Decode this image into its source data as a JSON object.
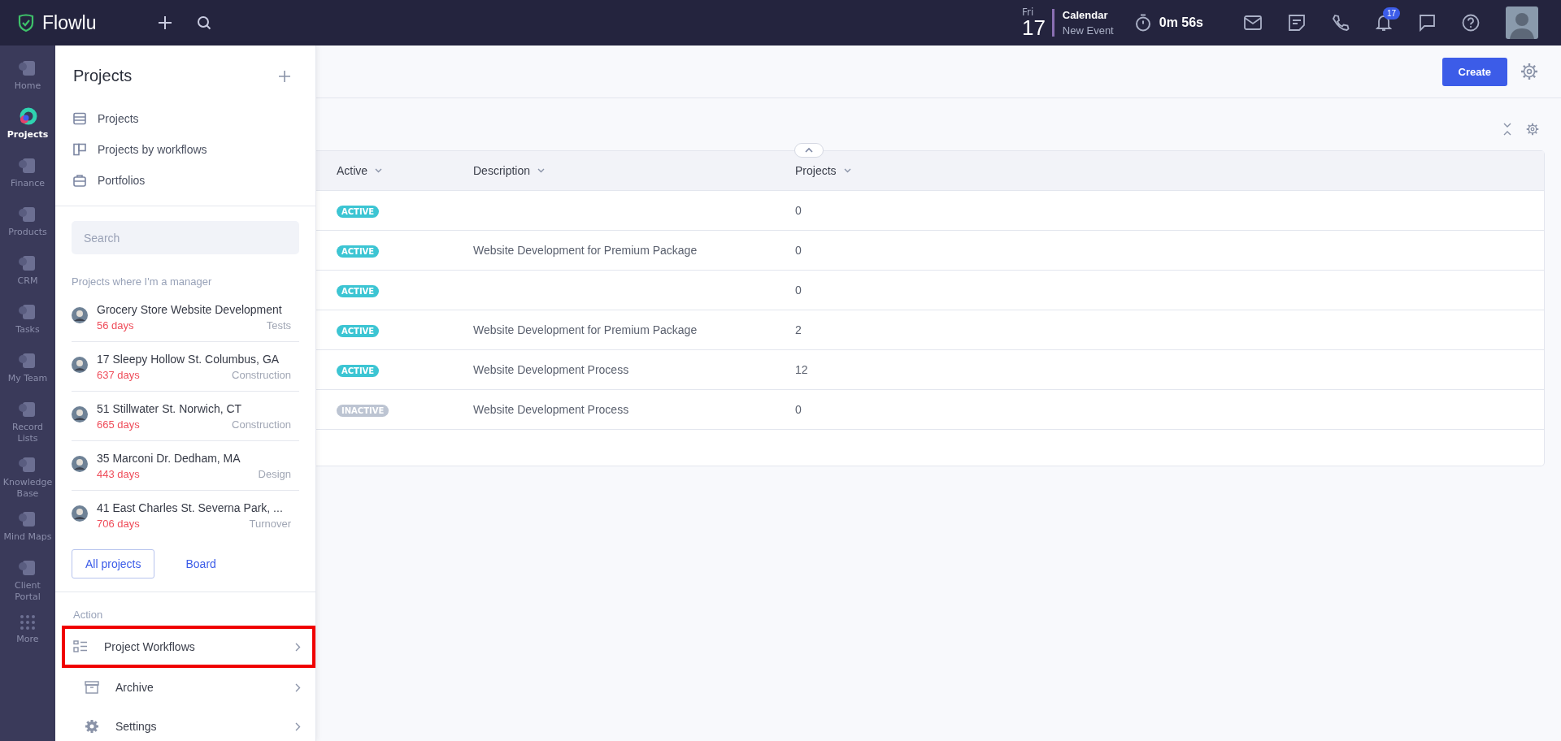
{
  "topbar": {
    "logo": "Flowlu",
    "day_name": "Fri",
    "day_number": "17",
    "calendar_title": "Calendar",
    "calendar_subtitle": "New Event",
    "timer": "0m 56s",
    "notification_count": "17"
  },
  "rail": [
    {
      "label": "Home",
      "selected": false
    },
    {
      "label": "Projects",
      "selected": true
    },
    {
      "label": "Finance",
      "selected": false
    },
    {
      "label": "Products",
      "selected": false
    },
    {
      "label": "CRM",
      "selected": false
    },
    {
      "label": "Tasks",
      "selected": false
    },
    {
      "label": "My Team",
      "selected": false
    },
    {
      "label": "Record Lists",
      "selected": false
    },
    {
      "label": "Knowledge Base",
      "selected": false
    },
    {
      "label": "Mind Maps",
      "selected": false
    },
    {
      "label": "Client Portal",
      "selected": false
    },
    {
      "label": "More",
      "selected": false
    }
  ],
  "panel": {
    "title": "Projects",
    "views": [
      {
        "label": "Projects",
        "kind": "list"
      },
      {
        "label": "Projects by workflows",
        "kind": "board"
      },
      {
        "label": "Portfolios",
        "kind": "portfolio"
      }
    ],
    "search": {
      "placeholder": "Search"
    },
    "section_label": "Projects where I'm a manager",
    "projects": [
      {
        "name": "Grocery Store Website Development",
        "days": "56 days",
        "stage": "Tests"
      },
      {
        "name": "17 Sleepy Hollow St. Columbus, GA",
        "days": "637 days",
        "stage": "Construction"
      },
      {
        "name": "51 Stillwater St. Norwich, CT",
        "days": "665 days",
        "stage": "Construction"
      },
      {
        "name": "35 Marconi Dr. Dedham, MA",
        "days": "443 days",
        "stage": "Design"
      },
      {
        "name": "41 East Charles St. Severna Park, ...",
        "days": "706 days",
        "stage": "Turnover"
      }
    ],
    "buttons": [
      {
        "label": "All projects",
        "kind": "outline"
      },
      {
        "label": "Board",
        "kind": "link"
      }
    ],
    "action_label": "Action",
    "actions": [
      {
        "label": "Project Workflows",
        "kind": "workflow",
        "highlighted": true
      },
      {
        "label": "Archive",
        "kind": "archive",
        "highlighted": false
      },
      {
        "label": "Settings",
        "kind": "settings",
        "highlighted": false
      }
    ]
  },
  "main": {
    "create_button": "Create",
    "table": {
      "columns": [
        "Active",
        "Description",
        "Projects"
      ],
      "rows": [
        {
          "status": "ACTIVE",
          "kind": "active",
          "description": "",
          "projects": "0"
        },
        {
          "status": "ACTIVE",
          "kind": "active",
          "description": "Website Development for Premium Package",
          "projects": "0"
        },
        {
          "status": "ACTIVE",
          "kind": "active",
          "description": "",
          "projects": "0"
        },
        {
          "status": "ACTIVE",
          "kind": "active",
          "description": "Website Development for Premium Package",
          "projects": "2"
        },
        {
          "status": "ACTIVE",
          "kind": "active",
          "description": "Website Development Process",
          "projects": "12"
        },
        {
          "status": "INACTIVE",
          "kind": "inactive",
          "description": "Website Development Process",
          "projects": "0"
        }
      ]
    }
  }
}
